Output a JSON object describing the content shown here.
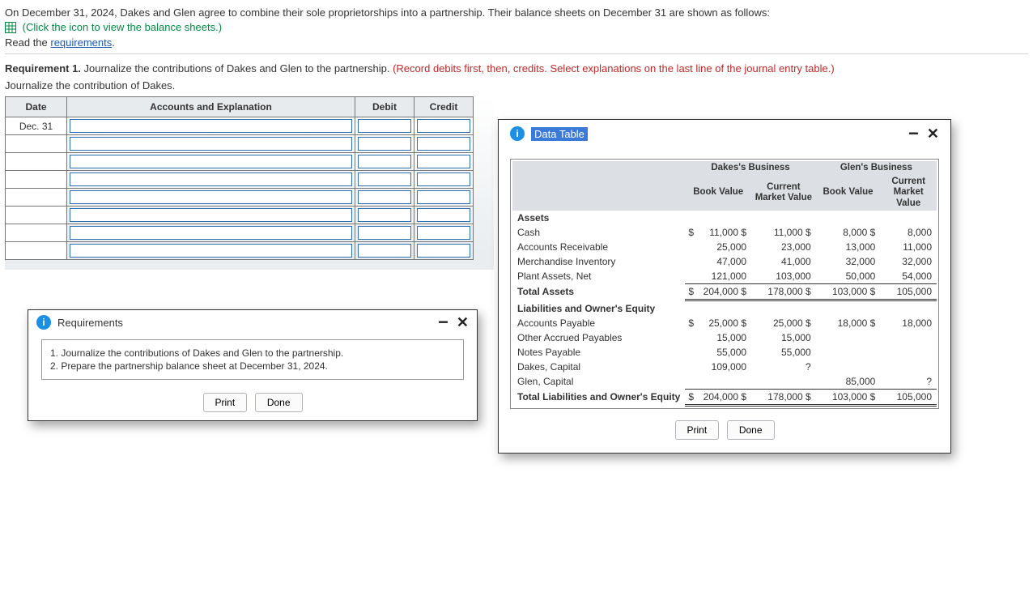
{
  "intro": {
    "line1": "On December 31, 2024, Dakes and Glen agree to combine their sole proprietorships into a partnership. Their balance sheets on December 31 are shown as follows:",
    "balance_link": "(Click the icon to view the balance sheets.)",
    "read_prefix": "Read the ",
    "requirements_link": "requirements",
    "read_suffix": "."
  },
  "requirement": {
    "bold": "Requirement 1.",
    "text": " Journalize the contributions of Dakes and Glen to the partnership. ",
    "note": "(Record debits first, then, credits. Select explanations on the last line of the journal entry table.)",
    "sub": "Journalize the contribution of Dakes."
  },
  "journal": {
    "headers": {
      "date": "Date",
      "acct": "Accounts and Explanation",
      "debit": "Debit",
      "credit": "Credit"
    },
    "date": "Dec. 31",
    "rows": 8
  },
  "req_dialog": {
    "title": "Requirements",
    "item1": "1. Journalize the contributions of Dakes and Glen to the partnership.",
    "item2": "2. Prepare the partnership balance sheet at December 31, 2024."
  },
  "buttons": {
    "print": "Print",
    "done": "Done"
  },
  "data_dialog": {
    "title": "Data Table",
    "group1": "Dakes's Business",
    "group2": "Glen's Business",
    "sub_book": "Book Value",
    "sub_cmv": "Current Market Value",
    "sub_cmv2": "Current Market Value",
    "sections": {
      "assets": "Assets",
      "liab": "Liabilities and Owner's Equity"
    },
    "rows": [
      {
        "label": "Cash",
        "d_sym": "$",
        "d_bv": "11,000",
        "d_sym2": "$",
        "d_mv": "11,000",
        "g_sym": "$",
        "g_bv": "8,000",
        "g_sym2": "$",
        "g_mv": "8,000"
      },
      {
        "label": "Accounts Receivable",
        "d_bv": "25,000",
        "d_mv": "23,000",
        "g_bv": "13,000",
        "g_mv": "11,000"
      },
      {
        "label": "Merchandise Inventory",
        "d_bv": "47,000",
        "d_mv": "41,000",
        "g_bv": "32,000",
        "g_mv": "32,000"
      },
      {
        "label": "Plant Assets, Net",
        "d_bv": "121,000",
        "d_mv": "103,000",
        "g_bv": "50,000",
        "g_mv": "54,000",
        "class": "sub-underline"
      }
    ],
    "total_assets": {
      "label": "Total Assets",
      "d_sym": "$",
      "d_bv": "204,000",
      "d_sym2": "$",
      "d_mv": "178,000",
      "g_sym": "$",
      "g_bv": "103,000",
      "g_sym2": "$",
      "g_mv": "105,000"
    },
    "liab_rows": [
      {
        "label": "Accounts Payable",
        "d_sym": "$",
        "d_bv": "25,000",
        "d_sym2": "$",
        "d_mv": "25,000",
        "g_sym": "$",
        "g_bv": "18,000",
        "g_sym2": "$",
        "g_mv": "18,000"
      },
      {
        "label": "Other Accrued Payables",
        "d_bv": "15,000",
        "d_mv": "15,000",
        "g_bv": "",
        "g_mv": ""
      },
      {
        "label": "Notes Payable",
        "d_bv": "55,000",
        "d_mv": "55,000",
        "g_bv": "",
        "g_mv": ""
      },
      {
        "label": "Dakes, Capital",
        "d_bv": "109,000",
        "d_mv": "?",
        "g_bv": "",
        "g_mv": ""
      },
      {
        "label": "Glen, Capital",
        "d_bv": "",
        "d_mv": "",
        "g_bv": "85,000",
        "g_mv": "?",
        "class": "sub-underline"
      }
    ],
    "total_liab": {
      "label": "Total Liabilities and Owner's Equity",
      "d_sym": "$",
      "d_bv": "204,000",
      "d_sym2": "$",
      "d_mv": "178,000",
      "g_sym": "$",
      "g_bv": "103,000",
      "g_sym2": "$",
      "g_mv": "105,000"
    }
  }
}
